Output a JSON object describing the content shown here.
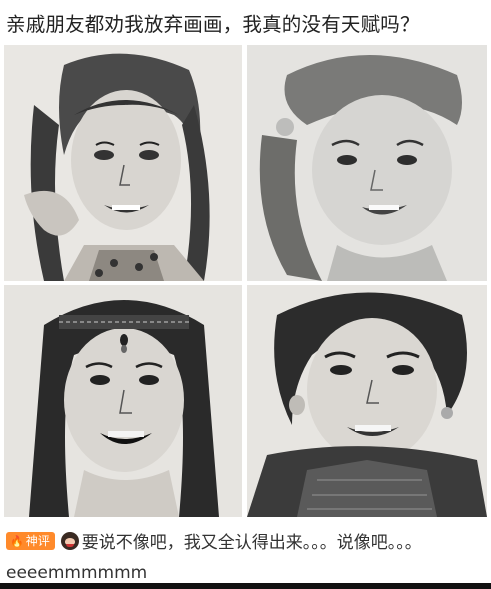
{
  "post": {
    "title": "亲戚朋友都劝我放弃画画，我真的没有天赋吗？"
  },
  "gallery": {
    "images": [
      {
        "icon": "sketch-portrait-girl-braids"
      },
      {
        "icon": "sketch-portrait-girl-ponytail"
      },
      {
        "icon": "sketch-portrait-woman-headband"
      },
      {
        "icon": "sketch-portrait-woman-earrings"
      }
    ]
  },
  "comment": {
    "badge": "神评",
    "badge_icon": "flame-icon",
    "avatar_icon": "emoji-face-icon",
    "text": "要说不像吧，我又全认得出来。。。说像吧。。。eeeemmmmmm"
  },
  "colors": {
    "badge": "#ff8a2b",
    "text": "#222222"
  }
}
